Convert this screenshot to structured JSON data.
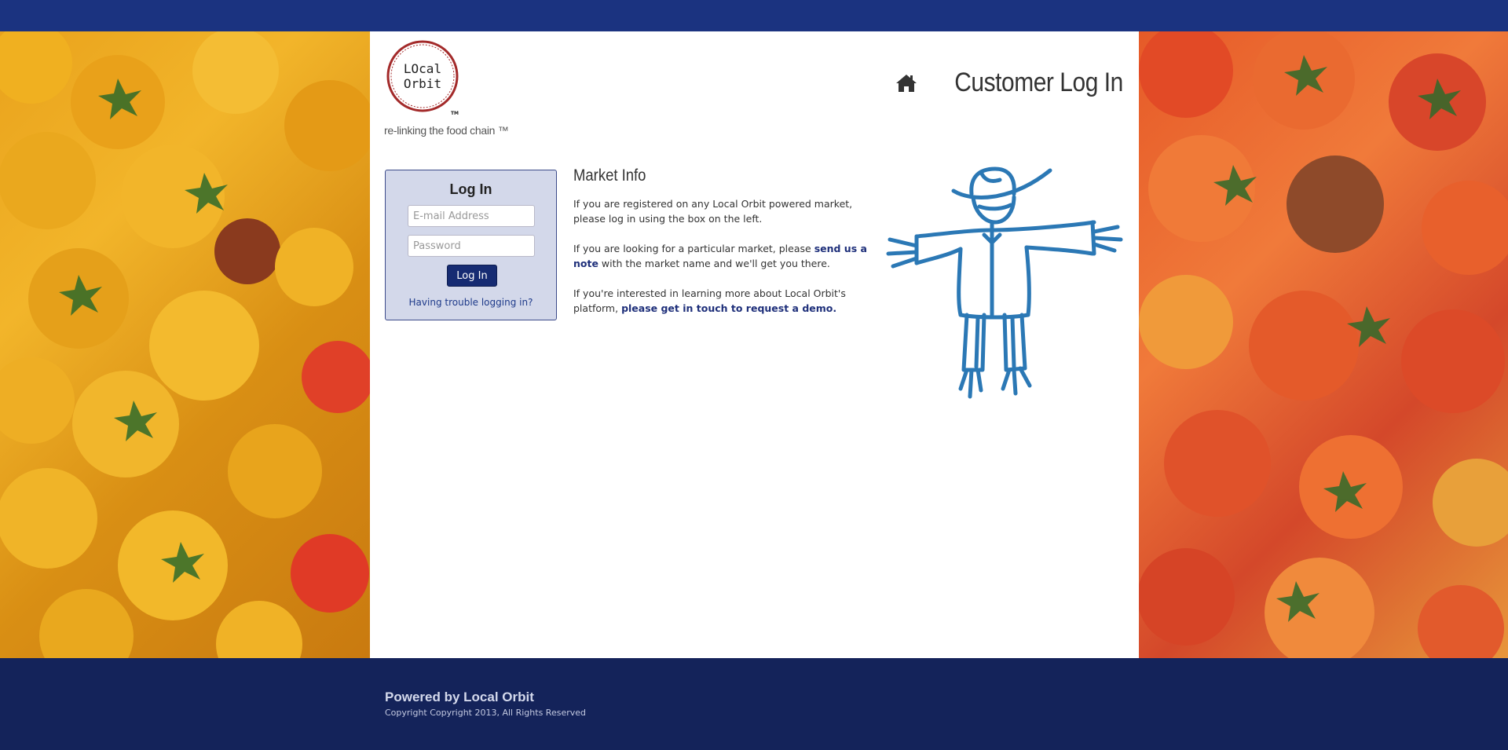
{
  "header": {
    "title": "Customer Log In",
    "home_icon": "home-icon"
  },
  "brand": {
    "logo_text_line1": "LOcal",
    "logo_text_line2": "Orbit",
    "logo_tm": "TM",
    "tagline": "re-linking the food chain ™"
  },
  "login": {
    "title": "Log In",
    "email_placeholder": "E-mail Address",
    "email_value": "",
    "password_placeholder": "Password",
    "password_value": "",
    "submit_label": "Log In",
    "trouble_link": "Having trouble logging in?"
  },
  "market_info": {
    "title": "Market Info",
    "p1": "If you are registered on any Local Orbit powered market, please log in using the box on the left.",
    "p2_prefix": "If you are looking for a particular market, please ",
    "p2_link": "send us a note",
    "p2_suffix": " with the market name and we'll get you there.",
    "p3_prefix": "If you're interested in learning more about Local Orbit's platform, ",
    "p3_link": "please get in touch to request a demo."
  },
  "footer": {
    "powered_by": "Powered by Local Orbit",
    "copyright": "Copyright Copyright 2013, All Rights Reserved"
  },
  "colors": {
    "top_bar": "#1b3380",
    "footer_bg": "#14235a",
    "login_box_bg": "#d3d8ea",
    "button_bg": "#162b72",
    "link": "#1e2f7a",
    "logo_ring": "#a32a2a",
    "scarecrow": "#2b78b5"
  }
}
